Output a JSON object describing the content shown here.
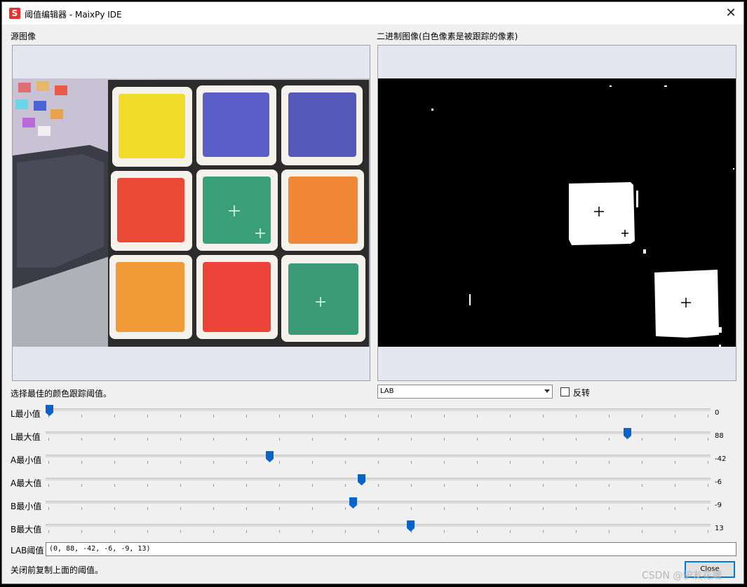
{
  "window": {
    "title": "阈值编辑器 - MaixPy IDE",
    "app_icon_letter": "S",
    "close_glyph": "✕"
  },
  "source_panel": {
    "label": "源图像"
  },
  "binary_panel": {
    "label": "二进制图像(白色像素是被跟踪的像素)"
  },
  "instruction": "选择最佳的颜色跟踪阈值。",
  "color_space": {
    "selected": "LAB"
  },
  "invert": {
    "label": "反转",
    "checked": false
  },
  "sliders": [
    {
      "label": "L最小值",
      "value": "0",
      "fraction": 0.0
    },
    {
      "label": "L最大值",
      "value": "88",
      "fraction": 0.88
    },
    {
      "label": "A最小值",
      "value": "-42",
      "fraction": 0.335
    },
    {
      "label": "A最大值",
      "value": "-6",
      "fraction": 0.475
    },
    {
      "label": "B最小值",
      "value": "-9",
      "fraction": 0.463
    },
    {
      "label": "B最大值",
      "value": "13",
      "fraction": 0.55
    }
  ],
  "threshold": {
    "label": "LAB阈值",
    "value": "(0, 88, -42, -6, -9, 13)"
  },
  "footer_note": "关闭前复制上面的阈值。",
  "close_button": {
    "label": "Close"
  },
  "watermark": "CSDN @驴友花雕",
  "colors": {
    "handle": "#0a63c7",
    "cube_yellow": "#f0dc2a",
    "cube_blue": "#5a5ec8",
    "cube_red": "#ec4a38",
    "cube_green": "#3aa07a",
    "cube_orange": "#f08838",
    "cube_white": "#f4f2ea",
    "highlight_border": "#0078d7"
  },
  "icons": [
    "app-logo-icon",
    "close-icon",
    "dropdown-arrow-icon",
    "checkbox-icon",
    "crosshair-icon"
  ]
}
